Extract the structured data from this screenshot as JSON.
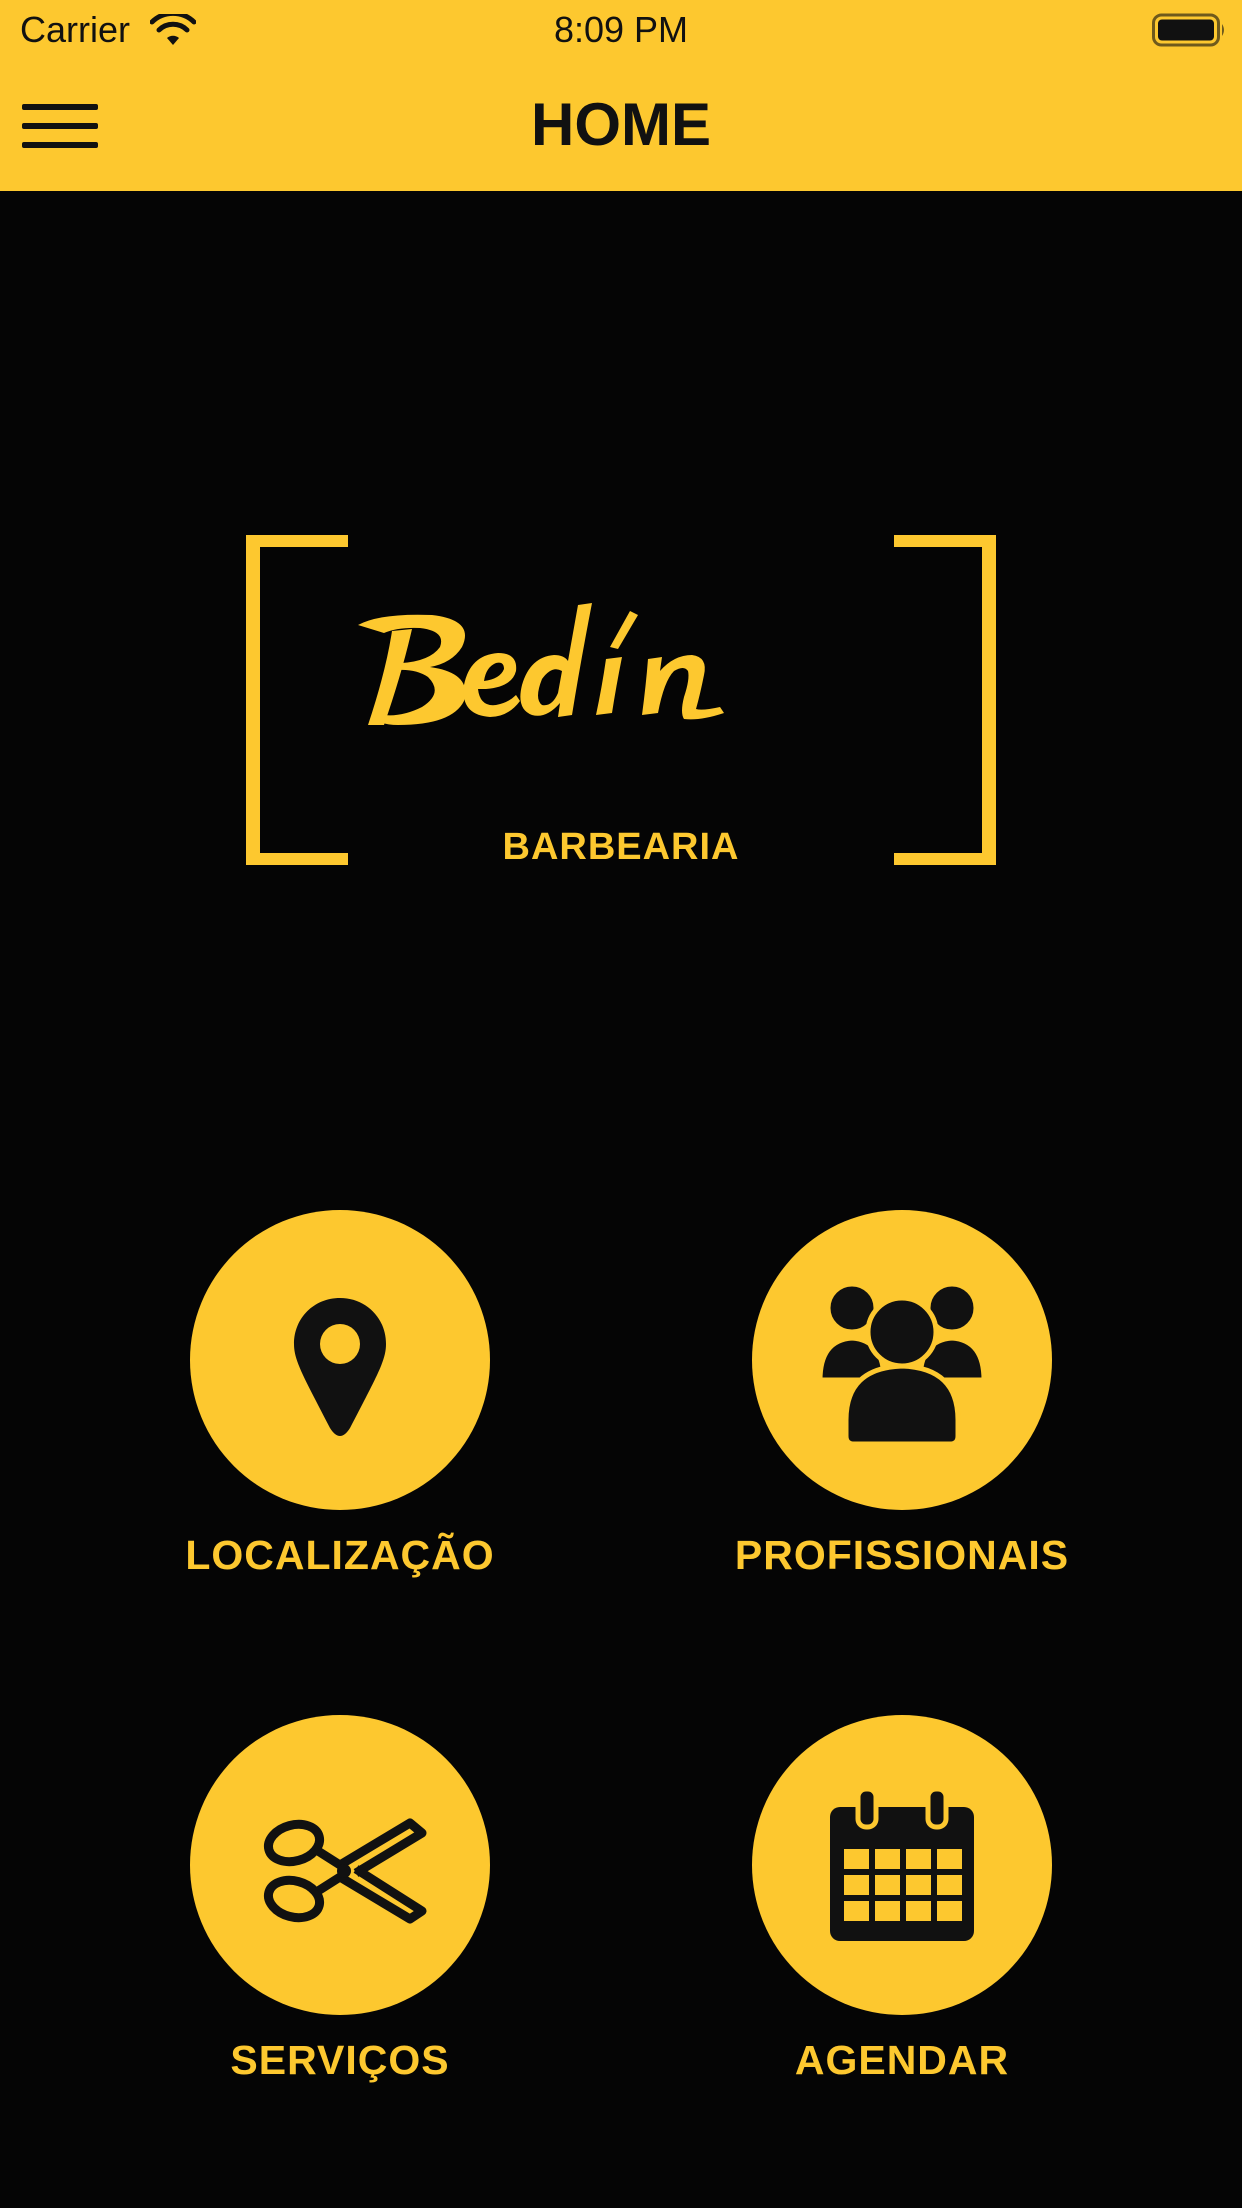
{
  "status_bar": {
    "carrier": "Carrier",
    "time": "8:09 PM",
    "wifi_icon": "wifi-icon",
    "battery_icon": "battery-icon"
  },
  "nav": {
    "title": "HOME",
    "menu_icon": "hamburger-menu-icon"
  },
  "logo": {
    "script": "Bedin",
    "subtitle": "BARBEARIA"
  },
  "menu": [
    {
      "label": "LOCALIZAÇÃO",
      "icon": "location-pin-icon"
    },
    {
      "label": "PROFISSIONAIS",
      "icon": "users-group-icon"
    },
    {
      "label": "SERVIÇOS",
      "icon": "scissors-icon"
    },
    {
      "label": "AGENDAR",
      "icon": "calendar-icon"
    }
  ],
  "colors": {
    "accent": "#FDC82F",
    "background": "#050505",
    "ink": "#111111"
  }
}
